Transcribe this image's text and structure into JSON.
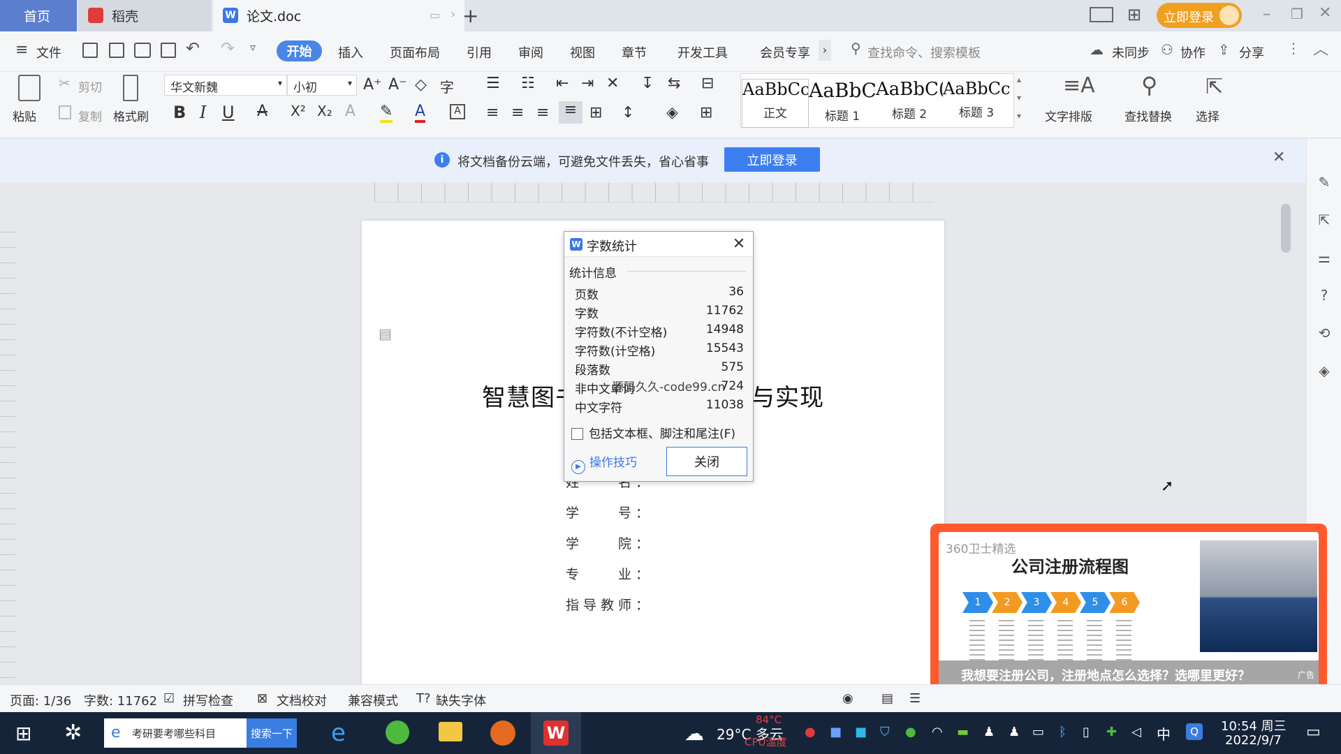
{
  "titlebar": {
    "tab_home": "首页",
    "tab_daoke": "稻壳",
    "tab_doc": "论文.doc",
    "login": "立即登录"
  },
  "menubar": {
    "file": "文件",
    "start": "开始",
    "insert": "插入",
    "layout": "页面布局",
    "reference": "引用",
    "review": "审阅",
    "view": "视图",
    "chapter": "章节",
    "devtools": "开发工具",
    "vip": "会员专享",
    "search_placeholder": "查找命令、搜索模板",
    "unsynced": "未同步",
    "collab": "协作",
    "share": "分享"
  },
  "ribbon": {
    "paste": "粘贴",
    "cut": "剪切",
    "copy": "复制",
    "format_painter": "格式刷",
    "font": "华文新魏",
    "size": "小初",
    "styles": [
      {
        "preview": "AaBbCcI",
        "name": "正文"
      },
      {
        "preview": "AaBbC",
        "name": "标题 1"
      },
      {
        "preview": "AaBbC(",
        "name": "标题 2"
      },
      {
        "preview": "AaBbCc",
        "name": "标题 3"
      }
    ],
    "text_layout": "文字排版",
    "find_replace": "查找替换",
    "select": "选择"
  },
  "notice": {
    "text": "将文档备份云端，可避免文件丢失，省心省事",
    "button": "立即登录"
  },
  "document": {
    "title": "智慧图书馆管理系统设计与实现",
    "fields": [
      "姓　　名：",
      "学　　号：",
      "学　　院：",
      "专　　业：",
      "指导教师："
    ]
  },
  "dialog": {
    "title": "字数统计",
    "section": "统计信息",
    "stats": [
      {
        "label": "页数",
        "value": "36"
      },
      {
        "label": "字数",
        "value": "11762"
      },
      {
        "label": "字符数(不计空格)",
        "value": "14948"
      },
      {
        "label": "字符数(计空格)",
        "value": "15543"
      },
      {
        "label": "段落数",
        "value": "575"
      },
      {
        "label": "非中文单词",
        "value": "724"
      },
      {
        "label": "中文字符",
        "value": "11038"
      }
    ],
    "include_label": "包括文本框、脚注和尾注(F)",
    "tips": "操作技巧",
    "close_button": "关闭"
  },
  "watermark": "源码久久-code99.cn",
  "ad": {
    "source": "360卫士精选",
    "title": "公司注册流程图",
    "caption": "我想要注册公司，注册地点怎么选择？选哪里更好？",
    "tag": "广告"
  },
  "statusbar": {
    "page": "页面: 1/36",
    "words": "字数: 11762",
    "spellcheck": "拼写检查",
    "proofread": "文档校对",
    "compat": "兼容模式",
    "missing_font": "缺失字体"
  },
  "taskbar": {
    "search_text": "考研要考哪些科目",
    "search_btn": "搜索一下",
    "weather": "29°C 多云",
    "cpu_temp": "84°C",
    "cpu_label": "CPU温度",
    "ime": "中",
    "time": "10:54 周三",
    "date": "2022/9/7"
  },
  "colors": {
    "accent": "#4a86e8",
    "tab_home": "#5b7fce",
    "ad_border": "#ff5a2e",
    "taskbar": "#16243a"
  }
}
